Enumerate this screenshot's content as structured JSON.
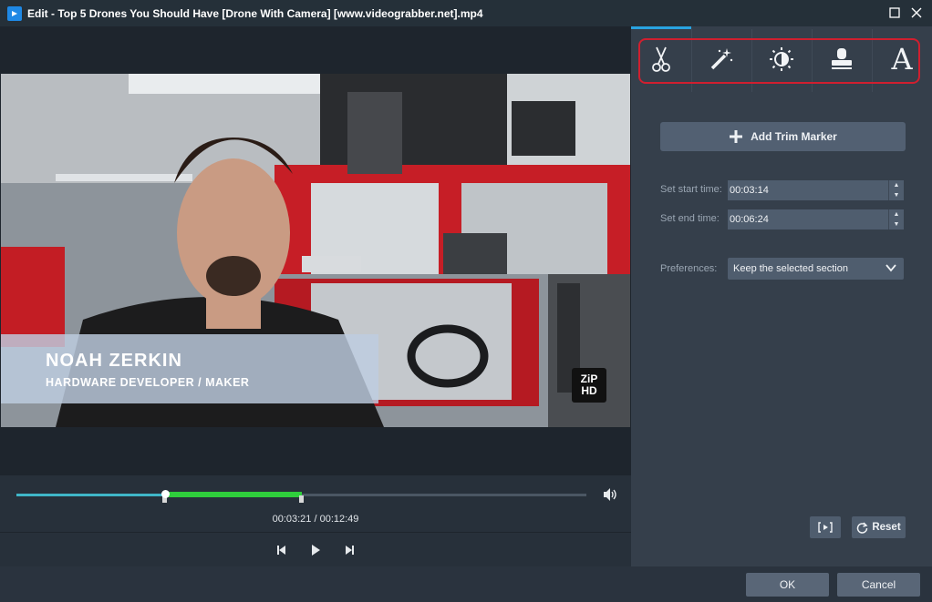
{
  "window": {
    "title": "Edit - Top 5  Drones You Should Have [Drone With Camera] [www.videograbber.net].mp4"
  },
  "video": {
    "lower_third_name": "NOAH ZERKIN",
    "lower_third_title": "HARDWARE DEVELOPER / MAKER",
    "watermark_line1": "ZiP",
    "watermark_line2": "HD"
  },
  "player": {
    "timecode": "00:03:21 / 00:12:49",
    "progress": 0.26,
    "selection_start": 0.26,
    "selection_end": 0.5
  },
  "tools": {
    "tabs": [
      {
        "name": "trim",
        "icon": "scissors-icon"
      },
      {
        "name": "effects",
        "icon": "magic-wand-icon"
      },
      {
        "name": "adjust",
        "icon": "brightness-icon"
      },
      {
        "name": "watermark",
        "icon": "stamp-icon"
      },
      {
        "name": "text",
        "icon": "text-icon",
        "glyph": "A"
      }
    ]
  },
  "trim": {
    "add_marker_label": "Add Trim Marker",
    "start_label": "Set start time:",
    "start_value": "00:03:14",
    "end_label": "Set end time:",
    "end_value": "00:06:24",
    "preferences_label": "Preferences:",
    "preferences_value": "Keep the selected section",
    "reset_label": "Reset"
  },
  "footer": {
    "ok_label": "OK",
    "cancel_label": "Cancel"
  },
  "colors": {
    "accent": "#29a3e0",
    "selection": "#2fce3c",
    "highlight_outline": "#d01f2f"
  }
}
